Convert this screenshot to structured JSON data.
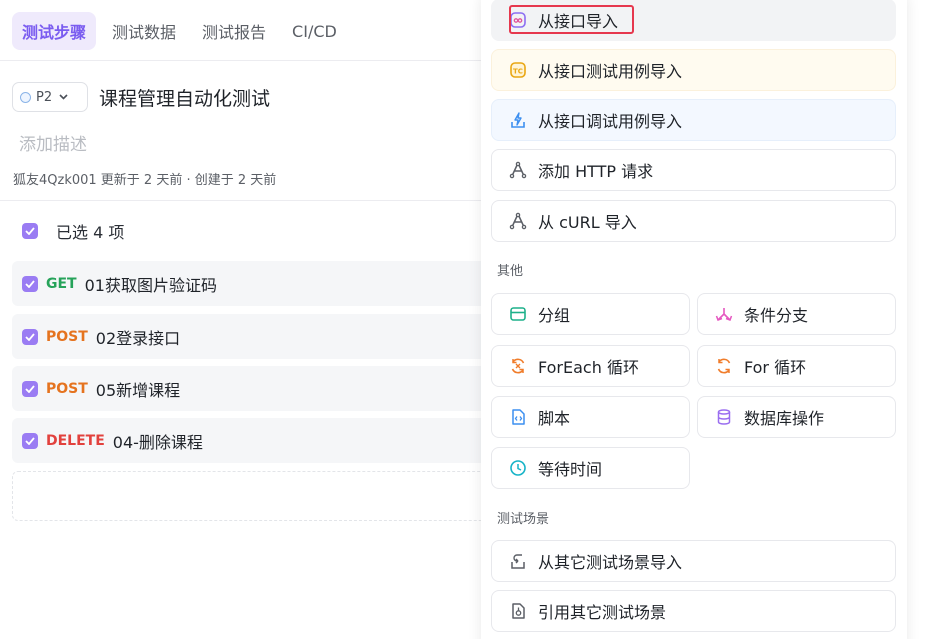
{
  "tabs": [
    "测试步骤",
    "测试数据",
    "测试报告",
    "CI/CD"
  ],
  "case": {
    "priority": "P2",
    "title": "课程管理自动化测试",
    "description_placeholder": "添加描述",
    "meta": "狐友4Qzk001 更新于 2 天前 · 创建于 2 天前"
  },
  "selection": {
    "label": "已选 4 项"
  },
  "steps": [
    {
      "method": "GET",
      "name": "01获取图片验证码"
    },
    {
      "method": "POST",
      "name": "02登录接口"
    },
    {
      "method": "POST",
      "name": "05新增课程"
    },
    {
      "method": "DELETE",
      "name": "04-删除课程"
    }
  ],
  "menu": {
    "import_items": [
      {
        "label": "从接口导入",
        "icon": "api-import-icon"
      },
      {
        "label": "从接口测试用例导入",
        "icon": "tc-icon"
      },
      {
        "label": "从接口调试用例导入",
        "icon": "debug-case-icon"
      },
      {
        "label": "添加 HTTP 请求",
        "icon": "http-request-icon"
      },
      {
        "label": "从 cURL 导入",
        "icon": "curl-icon"
      }
    ],
    "other_title": "其他",
    "other_items": [
      {
        "label": "分组",
        "icon": "group-icon"
      },
      {
        "label": "条件分支",
        "icon": "branch-icon"
      },
      {
        "label": "ForEach 循环",
        "icon": "foreach-icon"
      },
      {
        "label": "For 循环",
        "icon": "for-loop-icon"
      },
      {
        "label": "脚本",
        "icon": "script-icon"
      },
      {
        "label": "数据库操作",
        "icon": "database-icon"
      },
      {
        "label": "等待时间",
        "icon": "clock-icon"
      }
    ],
    "scenario_title": "测试场景",
    "scenario_items": [
      {
        "label": "从其它测试场景导入",
        "icon": "scenario-import-icon"
      },
      {
        "label": "引用其它测试场景",
        "icon": "scenario-reference-icon"
      }
    ]
  },
  "colors": {
    "accent": "#7a5cf0",
    "get": "#26a35a",
    "post": "#e5731f",
    "delete": "#e2413d",
    "highlight_border": "#e6384e"
  }
}
